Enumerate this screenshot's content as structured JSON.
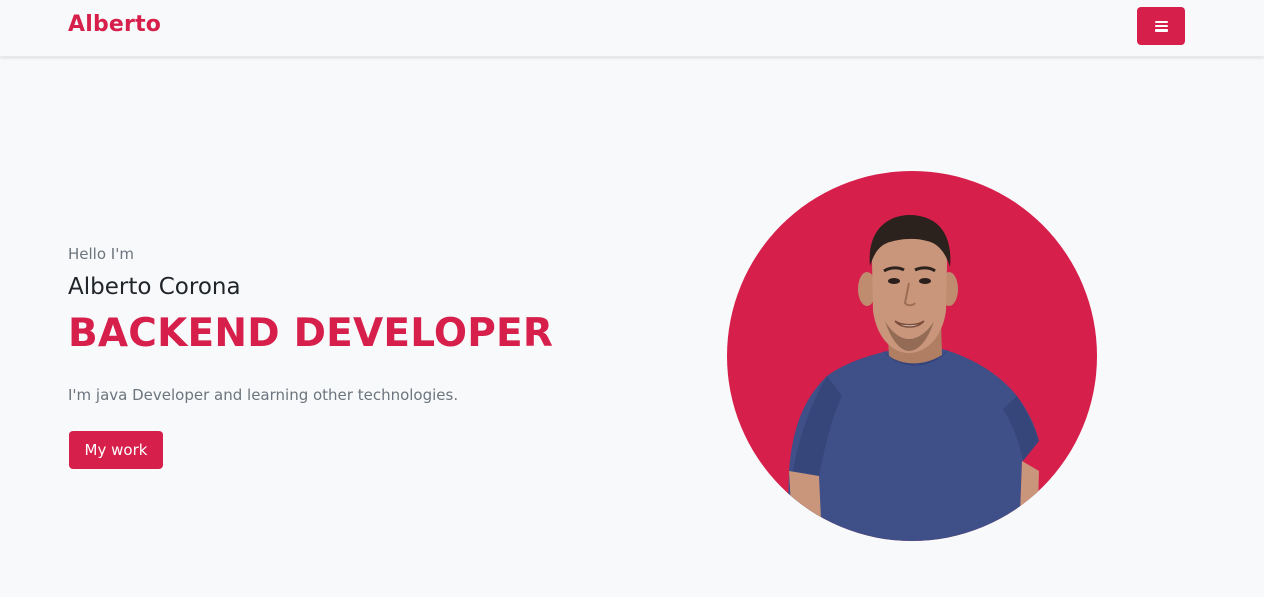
{
  "navbar": {
    "brand": "Alberto",
    "menu_icon": "hamburger-menu-icon"
  },
  "hero": {
    "greeting": "Hello I'm",
    "name": "Alberto Corona",
    "role": "BACKEND DEVELOPER",
    "tagline": "I'm java Developer and learning other technologies.",
    "cta_label": "My work"
  },
  "colors": {
    "accent": "#d6204b",
    "background": "#f8f9fb",
    "muted_text": "#6c757d",
    "dark_text": "#212529",
    "shirt": "#3f4f87"
  }
}
